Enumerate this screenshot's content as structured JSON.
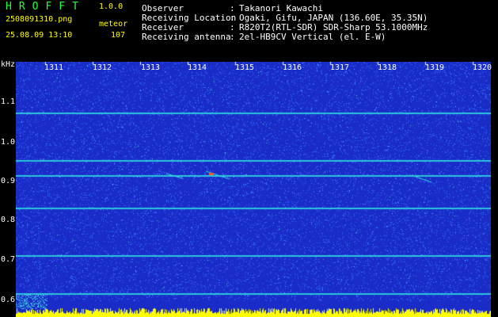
{
  "header": {
    "app_title": "HROFFT",
    "app_version": "1.0.0",
    "filename": "2508091310.png",
    "mode": "meteor",
    "datetime": "25.08.09 13:10",
    "count": "107",
    "info": [
      {
        "label": "Observer",
        "value": "Takanori Kawachi"
      },
      {
        "label": "Receiving Location",
        "value": "Ogaki, Gifu, JAPAN (136.60E, 35.35N)"
      },
      {
        "label": "Receiver",
        "value": "R820T2(RTL-SDR) SDR-Sharp 53.1000MHz"
      },
      {
        "label": "Receiving antenna",
        "value": "2el-HB9CV Vertical (el. E-W)"
      }
    ],
    "separator": ":"
  },
  "spectrogram": {
    "y_unit": "kHz",
    "y_ticks": [
      "1.1",
      "1.0",
      "0.9",
      "0.8",
      "0.7",
      "0.6"
    ],
    "x_ticks": [
      "1311",
      "1312",
      "1313",
      "1314",
      "1315",
      "1316",
      "1317",
      "1318",
      "1319",
      "1320"
    ],
    "colors": {
      "background": "#1a2cc8",
      "noise": "#2f6cff",
      "line": "#2fe0e0",
      "meteor": "#ff5030",
      "baseline": "#ffff00"
    }
  }
}
